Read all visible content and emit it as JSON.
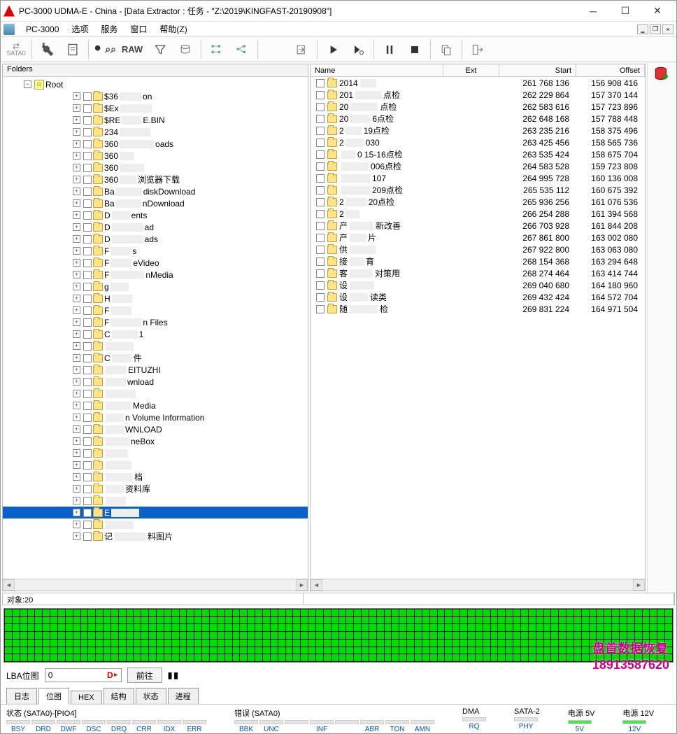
{
  "window": {
    "title": "PC-3000 UDMA-E - China - [Data Extractor : 任务 - \"Z:\\2019\\KINGFAST-20190908\"]"
  },
  "menu": {
    "app": "PC-3000",
    "items": [
      "选项",
      "服务",
      "窗口",
      "帮助(Z)"
    ]
  },
  "toolbar": {
    "sata_label": "SATA0",
    "raw": "RAW"
  },
  "left": {
    "header": "Folders",
    "root_label": "Root",
    "items": [
      {
        "pre": "$36",
        "suf": "on"
      },
      {
        "pre": "$Ex",
        "suf": ""
      },
      {
        "pre": "$RE",
        "suf": "E.BIN"
      },
      {
        "pre": "234",
        "suf": ""
      },
      {
        "pre": "360",
        "suf": "oads"
      },
      {
        "pre": "360",
        "suf": ""
      },
      {
        "pre": "360",
        "suf": ""
      },
      {
        "pre": "360",
        "suf": "浏览器下载"
      },
      {
        "pre": "Ba",
        "suf": "diskDownload"
      },
      {
        "pre": "Ba",
        "suf": "nDownload"
      },
      {
        "pre": "D",
        "suf": "ents"
      },
      {
        "pre": "D",
        "suf": "ad"
      },
      {
        "pre": "D",
        "suf": "ads"
      },
      {
        "pre": "F",
        "suf": "s"
      },
      {
        "pre": "F",
        "suf": "eVideo"
      },
      {
        "pre": "F",
        "suf": "nMedia"
      },
      {
        "pre": "g",
        "suf": ""
      },
      {
        "pre": "H",
        "suf": ""
      },
      {
        "pre": "F",
        "suf": ""
      },
      {
        "pre": "F",
        "suf": "n Files"
      },
      {
        "pre": "C",
        "suf": "1"
      },
      {
        "pre": "",
        "suf": ""
      },
      {
        "pre": "C",
        "suf": "件"
      },
      {
        "pre": "",
        "suf": "EITUZHI"
      },
      {
        "pre": "",
        "suf": "wnload"
      },
      {
        "pre": "",
        "suf": ""
      },
      {
        "pre": "",
        "suf": "Media"
      },
      {
        "pre": "",
        "suf": "n Volume Information"
      },
      {
        "pre": "",
        "suf": "WNLOAD"
      },
      {
        "pre": "",
        "suf": "neBox"
      },
      {
        "pre": "",
        "suf": ""
      },
      {
        "pre": "",
        "suf": ""
      },
      {
        "pre": "",
        "suf": "档"
      },
      {
        "pre": "",
        "suf": "资料库"
      },
      {
        "pre": "",
        "suf": ""
      },
      {
        "pre": "E",
        "suf": "",
        "selected": true
      },
      {
        "pre": "",
        "suf": ""
      },
      {
        "pre": "记",
        "suf": "料图片"
      }
    ]
  },
  "right": {
    "cols": {
      "name": "Name",
      "ext": "Ext",
      "start": "Start",
      "offset": "Offset"
    },
    "rows": [
      {
        "pre": "2014",
        "suf": "",
        "start": "261 768 136",
        "offset": "156 908 416"
      },
      {
        "pre": "201",
        "suf": "点检",
        "start": "262 229 864",
        "offset": "157 370 144"
      },
      {
        "pre": "20",
        "suf": "点检",
        "start": "262 583 616",
        "offset": "157 723 896"
      },
      {
        "pre": "20",
        "suf": "6点检",
        "start": "262 648 168",
        "offset": "157 788 448"
      },
      {
        "pre": "2",
        "suf": "19点检",
        "start": "263 235 216",
        "offset": "158 375 496"
      },
      {
        "pre": "2",
        "suf": "030",
        "start": "263 425 456",
        "offset": "158 565 736"
      },
      {
        "pre": "",
        "suf": "0 15-16点检",
        "start": "263 535 424",
        "offset": "158 675 704"
      },
      {
        "pre": "",
        "suf": "006点检",
        "start": "264 583 528",
        "offset": "159 723 808"
      },
      {
        "pre": "",
        "suf": "107",
        "start": "264 995 728",
        "offset": "160 136 008"
      },
      {
        "pre": "",
        "suf": "209点检",
        "start": "265 535 112",
        "offset": "160 675 392"
      },
      {
        "pre": "2",
        "suf": "20点检",
        "start": "265 936 256",
        "offset": "161 076 536"
      },
      {
        "pre": "2",
        "suf": "",
        "start": "266 254 288",
        "offset": "161 394 568"
      },
      {
        "pre": "产",
        "suf": "新改善",
        "start": "266 703 928",
        "offset": "161 844 208"
      },
      {
        "pre": "产",
        "suf": "片",
        "start": "267 861 800",
        "offset": "163 002 080"
      },
      {
        "pre": "供",
        "suf": "",
        "start": "267 922 800",
        "offset": "163 063 080"
      },
      {
        "pre": "接",
        "suf": "育",
        "start": "268 154 368",
        "offset": "163 294 648"
      },
      {
        "pre": "客",
        "suf": "对策用",
        "start": "268 274 464",
        "offset": "163 414 744"
      },
      {
        "pre": "设",
        "suf": "",
        "start": "269 040 680",
        "offset": "164 180 960"
      },
      {
        "pre": "设",
        "suf": "读类",
        "start": "269 432 424",
        "offset": "164 572 704"
      },
      {
        "pre": "随",
        "suf": "检",
        "start": "269 831 224",
        "offset": "164 971 504"
      }
    ]
  },
  "status": {
    "objects": "对象:20"
  },
  "nav": {
    "label": "LBA位图",
    "value": "0",
    "goto": "前往"
  },
  "tabs": [
    "日志",
    "位图",
    "HEX",
    "结构",
    "状态",
    "进程"
  ],
  "bottom": {
    "state_label": "状态 (SATA0)-[PIO4]",
    "state": [
      "BSY",
      "DRD",
      "DWF",
      "DSC",
      "DRQ",
      "CRR",
      "IDX",
      "ERR"
    ],
    "error_label": "错误 (SATA0)",
    "error": [
      "BBK",
      "UNC",
      "",
      "INF",
      "",
      "ABR",
      "TON",
      "AMN"
    ],
    "dma_label": "DMA",
    "dma": [
      "RQ"
    ],
    "sata2_label": "SATA-2",
    "sata2": [
      "PHY"
    ],
    "p5_label": "电源 5V",
    "p5": [
      "5V"
    ],
    "p12_label": "电源 12V",
    "p12": [
      "12V"
    ]
  },
  "watermark": {
    "text": "盘首数据恢复",
    "phone": "18913587620"
  }
}
